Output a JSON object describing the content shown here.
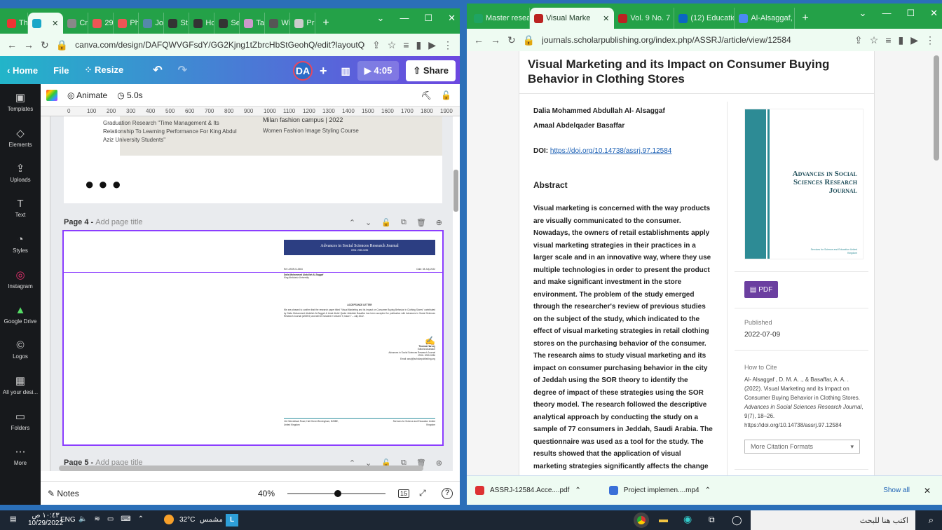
{
  "canva_tabs": [
    {
      "label": "Th",
      "icon": "youtube-icon",
      "color": "#e33"
    },
    {
      "label": "",
      "icon": "canva-icon",
      "color": "#18a7c8",
      "active": true
    },
    {
      "label": "Cn",
      "icon": "doc-icon",
      "color": "#888"
    },
    {
      "label": "29",
      "icon": "pdf-icon",
      "color": "#e55"
    },
    {
      "label": "Ph",
      "icon": "pdf-icon",
      "color": "#e55"
    },
    {
      "label": "Jo",
      "icon": "doc-icon",
      "color": "#58a"
    },
    {
      "label": "St",
      "icon": "s-icon",
      "color": "#333"
    },
    {
      "label": "Hc",
      "icon": "f-icon",
      "color": "#333"
    },
    {
      "label": "Se",
      "icon": "eye-icon",
      "color": "#333"
    },
    {
      "label": "Ta",
      "icon": "pdf-icon",
      "color": "#c9c"
    },
    {
      "label": "Wi",
      "icon": "doc-icon",
      "color": "#555"
    },
    {
      "label": "Pr",
      "icon": "page-icon",
      "color": "#ccc"
    }
  ],
  "canva_url": "canva.com/design/DAFQWVGFsdY/GG2Kjng1tZbrcHbStGeohQ/edit?layoutQuery=port...",
  "canva_menu": {
    "home": "Home",
    "file": "File",
    "resize": "Resize",
    "avatar": "DA",
    "time": "4:05",
    "share": "Share"
  },
  "canva_sidebar": [
    "Templates",
    "Elements",
    "Uploads",
    "Text",
    "Styles",
    "Instagram",
    "Google Drive",
    "Logos",
    "All your desi...",
    "Folders",
    "More"
  ],
  "canva_toolbar": {
    "animate": "Animate",
    "duration": "5.0s"
  },
  "ruler_h": [
    "0",
    "100",
    "200",
    "300",
    "400",
    "500",
    "600",
    "700",
    "800",
    "900",
    "1000",
    "1100",
    "1200",
    "1300",
    "1400",
    "1500",
    "1600",
    "1700",
    "1800",
    "1900"
  ],
  "page3": {
    "text1": "Graduation Research \"Time Management & Its Relationship To Learning Performance For King Abdul Aziz University Students\"",
    "text2": "Milan fashion campus | 2022",
    "text3": "Women Fashion Image Styling Course"
  },
  "page4": {
    "label": "Page 4 - ",
    "placeholder": "Add page title",
    "journal_header": "Advances in Social Sciences Research Journal",
    "issn": "ISSN: 2055-0286",
    "ref": "Ref: ASSRJ-12584",
    "date": "Date: 08 July 2022",
    "author": "Dalia Mohammed Abdullah Al-Saggaf",
    "university": "King Abdulaziz University",
    "letter_title": "ACCEPTANCE LETTER",
    "letter_body": "We are pleased to confirm that the research paper titled \"Visual Marketing and its Impact on Consumer Buying Behavior in Clothing Stores\" contributed by Dalia Mohammed Abdullah Al-Saggaf & Amal Abdel Qader Abdullah Basaffar has been accepted for publication with Advances in Social Sciences Research Journal (ASSRJ) and will be included in Volume 9, Issue 7 – July 2022.",
    "signer": "Thomas Harvey",
    "signer_role": "Editorial Assistant",
    "signer_org": "Advances in Social Sciences Research Journal",
    "signer_issn": "ISSN: 2055-0286",
    "signer_email": "Email: assrj@scholarpublishing.org",
    "footer_left": "144 Weedblack Road, Hall Green Birmingham, B28BE, United Kingdom",
    "footer_right": "Services for Science and Education United Kingdom"
  },
  "page5": {
    "label": "Page 5 - ",
    "placeholder": "Add page title"
  },
  "canva_bottom": {
    "notes": "Notes",
    "zoom": "40%",
    "pages": "15",
    "zoom_level": 0.4
  },
  "journal_tabs": [
    {
      "label": "Master resea",
      "icon": "drive-icon",
      "color": "#1fa463"
    },
    {
      "label": "Visual Marke",
      "icon": "journal-icon",
      "color": "#b22",
      "active": true
    },
    {
      "label": "Vol. 9 No. 7",
      "icon": "journal-icon",
      "color": "#b22"
    },
    {
      "label": "(12) Educatio",
      "icon": "linkedin-icon",
      "color": "#0a66c2"
    },
    {
      "label": "Al-Alsaggaf,",
      "icon": "scholar-icon",
      "color": "#4a8af4"
    }
  ],
  "journal_url": "journals.scholarpublishing.org/index.php/ASSRJ/article/view/12584",
  "article": {
    "title": "Visual Marketing and its Impact on Consumer Buying Behavior in Clothing Stores",
    "author1": "Dalia Mohammed Abdullah Al- Alsaggaf",
    "author2": "Amaal Abdelqader Basaffar",
    "doi_label": "DOI: ",
    "doi": "https://doi.org/10.14738/assrj.97.12584",
    "abstract_heading": "Abstract",
    "abstract": "Visual marketing is concerned with the way products are visually communicated to the consumer. Nowadays, the owners of retail establishments apply visual marketing strategies in their practices in a larger scale and in an innovative way, where they use multiple technologies in order to present the product and make significant investment in the store environment. The problem of the study emerged through the researcher's review of previous studies on the subject of the study, which indicated to the effect of visual marketing strategies in retail clothing stores on the purchasing behavior of the consumer. The research aims to study visual marketing and its impact on consumer purchasing behavior in the city of Jeddah using the SOR theory to identify the degree of impact of these strategies using the SOR theory model. The research followed the descriptive analytical approach by conducting the study on a sample of 77 consumers in Jeddah, Saudi Arabia. The questionnaire was used as a tool for the study. The results showed that the application of visual marketing strategies significantly affects the change",
    "cover_title": "Advances in Social Sciences Research Journal",
    "cover_publisher": "Services for Science and Education United Kingdom",
    "pdf": "PDF",
    "published_label": "Published",
    "published": "2022-07-09",
    "cite_label": "How to Cite",
    "cite_plain": "Al- Alsaggaf , D. M. A. ., & Basaffar, A. A. . (2022). Visual Marketing and its Impact on Consumer Buying Behavior in Clothing Stores. ",
    "cite_journal": "Advances in Social Sciences Research Journal",
    "cite_rest": ", 9(7), 18–26. https://doi.org/10.14738/assrj.97.12584",
    "cite_formats": "More Citation Formats"
  },
  "downloads": [
    {
      "name": "ASSRJ-12584.Acce....pdf",
      "icon": "pdf-icon"
    },
    {
      "name": "Project implemen....mp4",
      "icon": "video-icon"
    }
  ],
  "downloads_show_all": "Show all",
  "taskbar": {
    "time": "١٠:٤٣ ص",
    "date": "10/29/2022",
    "lang": "ENG",
    "weather_temp": "32°C",
    "weather_text": "مشمس",
    "search": "اكتب هنا للبحث"
  },
  "accent": "#24a148"
}
